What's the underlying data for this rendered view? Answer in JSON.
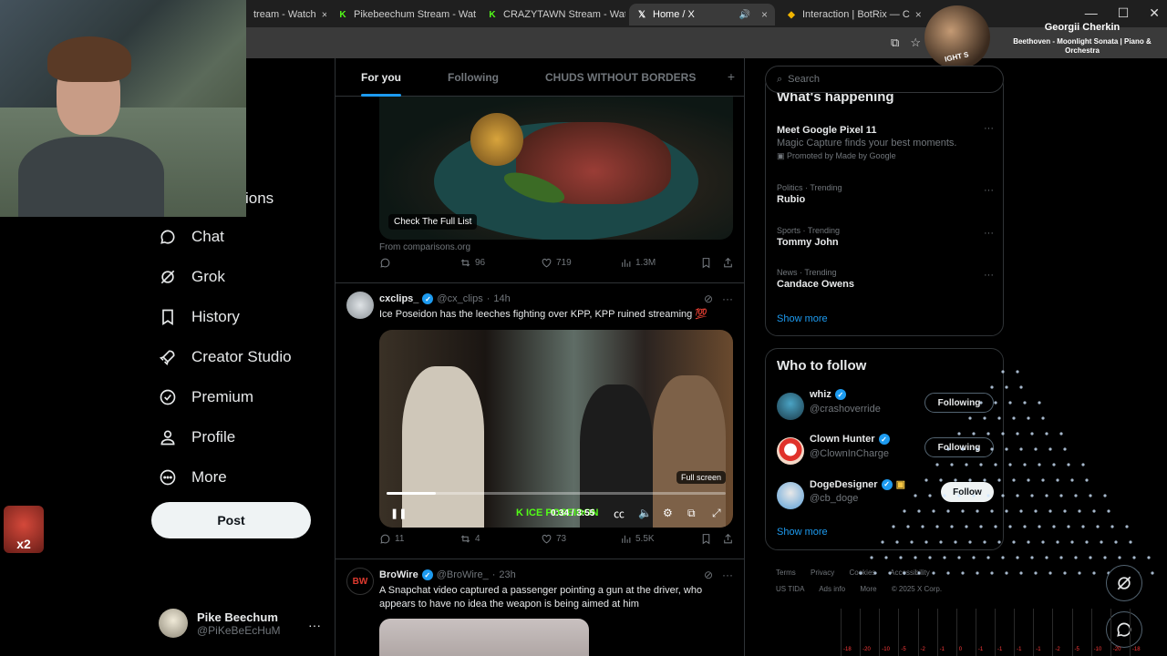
{
  "browser": {
    "tabs": [
      {
        "label": "tream - Watch",
        "favicon": "twitch-icon",
        "close": "×"
      },
      {
        "label": "Pikebeechum Stream - Watc",
        "favicon": "kick-icon",
        "close": "×"
      },
      {
        "label": "CRAZYTAWN Stream - Watc",
        "favicon": "kick-icon",
        "close": "×"
      },
      {
        "label": "Home / X",
        "favicon": "x-logo-icon",
        "close": "×",
        "active": true
      },
      {
        "label": "Interaction | BotRix — C",
        "favicon": "botrix-icon",
        "close": "×"
      }
    ],
    "ask_gemini": "Ask Gemini",
    "window_controls": {
      "minimize": "—",
      "maximize": "☐",
      "close": "✕"
    },
    "colors": {
      "tab_bar": "#1f1f1f",
      "active_tab": "#3a3a3a",
      "kick_green": "#53fc18"
    }
  },
  "sidebar": {
    "partial_label": "ions",
    "items": [
      {
        "label": "Chat",
        "icon": "chat-bubble-icon"
      },
      {
        "label": "Grok",
        "icon": "grok-icon"
      },
      {
        "label": "History",
        "icon": "bookmark-icon"
      },
      {
        "label": "Creator Studio",
        "icon": "rocket-icon"
      },
      {
        "label": "Premium",
        "icon": "verified-badge-icon"
      },
      {
        "label": "Profile",
        "icon": "person-icon"
      },
      {
        "label": "More",
        "icon": "more-circle-icon"
      }
    ],
    "post_label": "Post",
    "account": {
      "name": "Pike Beechum",
      "handle": "@PiKeBeEcHuM",
      "more": "···"
    }
  },
  "overlays": {
    "badge_text": "x2",
    "music": {
      "artist": "Georgii Cherkin",
      "song": "Beethoven - Moonlight Sonata | Piano & Orchestra",
      "art_tag": "IGHT S"
    },
    "meter_labels": [
      "-18",
      "-20",
      "-10",
      "-5",
      "-2",
      "-1",
      "0",
      "-1",
      "-1",
      "-1",
      "-1",
      "-2",
      "-5",
      "-10",
      "-20",
      "-18"
    ]
  },
  "feed": {
    "tabs": [
      {
        "label": "For you",
        "selected": true
      },
      {
        "label": "Following",
        "selected": false
      },
      {
        "label": "CHUDS WITHOUT BORDERS",
        "selected": false
      }
    ],
    "add_tab": "+",
    "ad": {
      "image_label": "Check The Full List",
      "source": "From comparisons.org",
      "stats": {
        "retweets": "96",
        "likes": "719",
        "views": "1.3M"
      }
    },
    "tweets": [
      {
        "name": "cxclips_",
        "handle": "@cx_clips",
        "time": "14h",
        "text": "Ice Poseidon has the leeches fighting over KPP, KPP ruined streaming 💯",
        "video": {
          "time": "0:34 / 3:55",
          "progress": 0.145,
          "fullscreen_label": "Full screen",
          "watermark": "ICE POSEIDON"
        },
        "stats": {
          "replies": "11",
          "retweets": "4",
          "likes": "73",
          "views": "5.5K"
        }
      },
      {
        "name": "BroWire",
        "handle": "@BroWire_",
        "time": "23h",
        "text": "A Snapchat video captured a passenger pointing a gun at the driver, who appears to have no idea the weapon is being aimed at him"
      }
    ]
  },
  "right": {
    "search_placeholder": "Search",
    "happening": {
      "title": "What's happening",
      "trends": [
        {
          "category": "",
          "title": "Meet Google Pixel 11",
          "desc": "Magic Capture finds your best moments.",
          "promo": "Promoted by Made by Google"
        },
        {
          "category": "Politics · Trending",
          "title": "Rubio"
        },
        {
          "category": "Sports · Trending",
          "title": "Tommy John"
        },
        {
          "category": "News · Trending",
          "title": "Candace Owens"
        }
      ],
      "show_more": "Show more"
    },
    "who_to_follow": {
      "title": "Who to follow",
      "users": [
        {
          "name": "whiz",
          "handle": "@crashoverride",
          "button": "Following"
        },
        {
          "name": "Clown Hunter",
          "handle": "@ClownInCharge",
          "button": "Following"
        },
        {
          "name": "DogeDesigner",
          "handle": "@cb_doge",
          "button": "Follow"
        }
      ],
      "show_more": "Show more"
    },
    "footer": [
      "Terms",
      "Privacy",
      "Cookies",
      "Accessibility",
      "US TIDA",
      "Ads info",
      "More",
      "© 2025 X Corp."
    ]
  }
}
